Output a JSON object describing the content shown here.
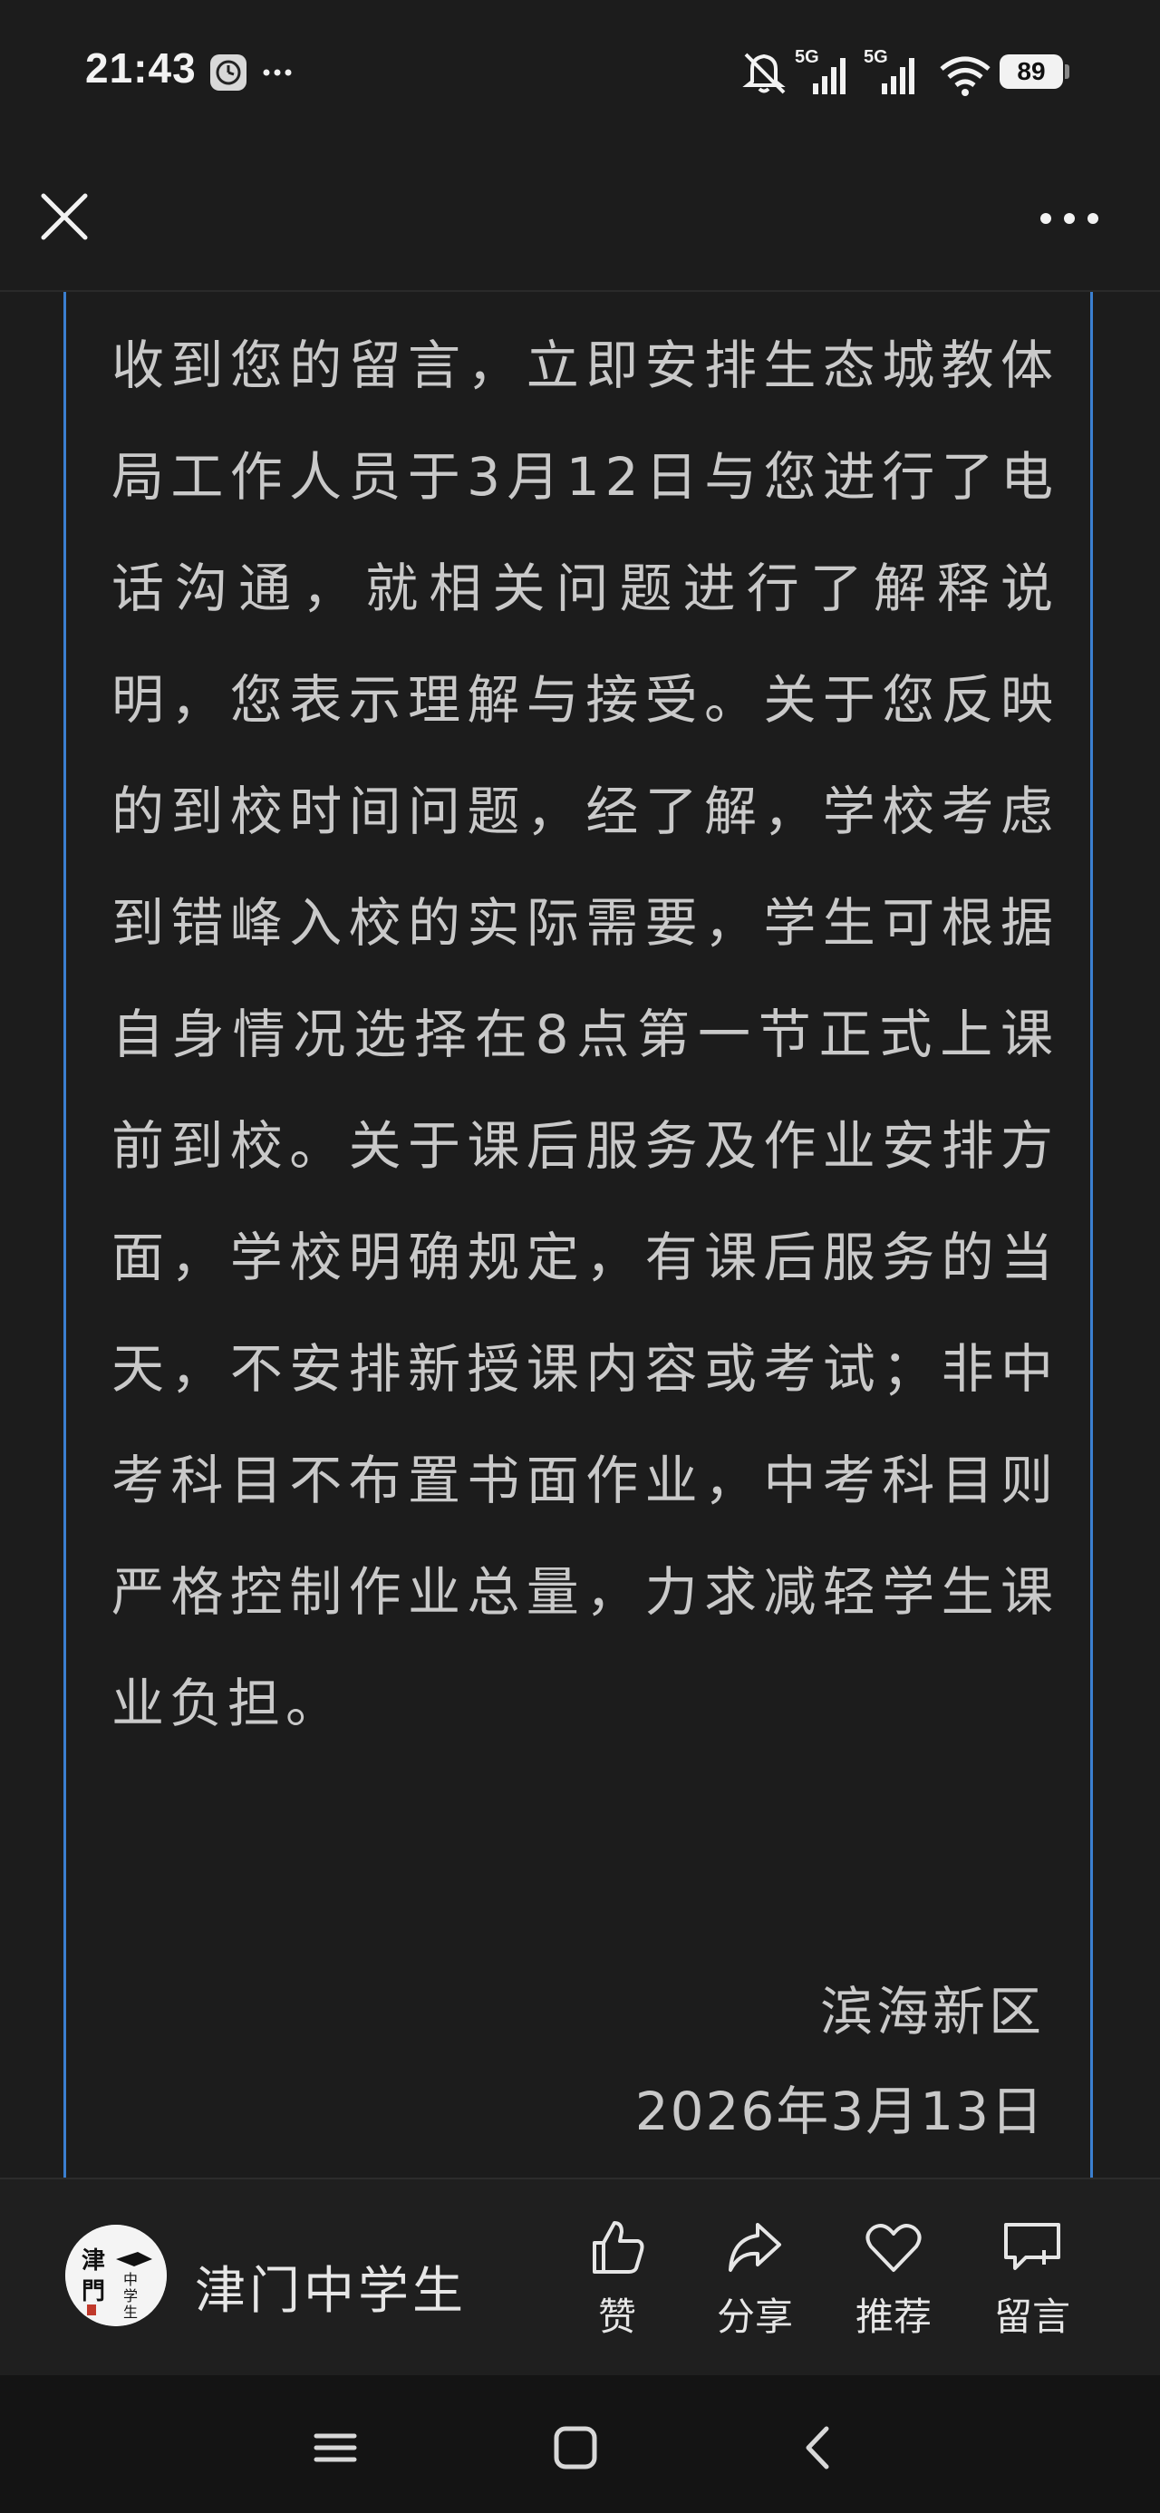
{
  "status_bar": {
    "time": "21:43",
    "signal_1": "5G",
    "signal_2": "5G",
    "battery": "89"
  },
  "article": {
    "body": "收到您的留言，立即安排生态城教体局工作人员于3月12日与您进行了电话沟通，就相关问题进行了解释说明，您表示理解与接受。关于您反映的到校时间问题，经了解，学校考虑到错峰入校的实际需要，学生可根据自身情况选择在8点第一节正式上课前到校。关于课后服务及作业安排方面，学校明确规定，有课后服务的当天，不安排新授课内容或考试；非中考科目不布置书面作业，中考科目则严格控制作业总量，力求减轻学生课业负担。",
    "signature": "滨海新区",
    "date": "2026年3月13日"
  },
  "account": {
    "name": "津门中学生",
    "logo_text": "津门中学生"
  },
  "actions": {
    "like": "赞",
    "share": "分享",
    "recommend": "推荐",
    "comment": "留言"
  },
  "colors": {
    "background": "#1c1c1c",
    "frame_border": "#3b7fd0",
    "text": "#c9c9c9"
  }
}
